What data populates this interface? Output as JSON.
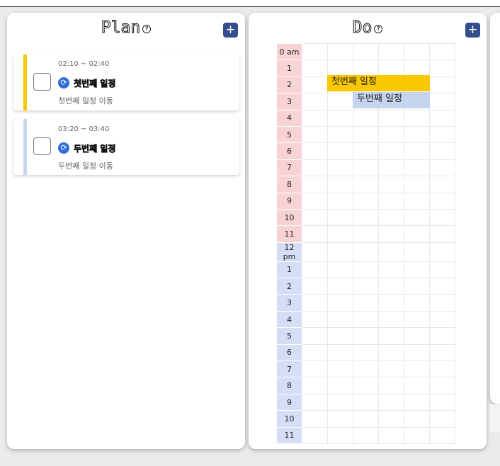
{
  "plan": {
    "title": "Plan",
    "help_icon": "?",
    "add_label": "+",
    "items": [
      {
        "time": "02:10 ~ 02:40",
        "name": "첫번째 일정",
        "desc": "첫번째 일정 이동",
        "color": "#f9c800"
      },
      {
        "time": "03:20 ~ 03:40",
        "name": "두번째 일정",
        "desc": "두번째 일정 이동",
        "color": "#c7d6ef"
      }
    ]
  },
  "do": {
    "title": "Do",
    "help_icon": "?",
    "add_label": "+",
    "hours": [
      "0 am",
      "1",
      "2",
      "3",
      "4",
      "5",
      "6",
      "7",
      "8",
      "9",
      "10",
      "11",
      "12 pm",
      "1",
      "2",
      "3",
      "4",
      "5",
      "6",
      "7",
      "8",
      "9",
      "10",
      "11"
    ],
    "events": [
      {
        "label": "첫번째 일정",
        "color": "#f9c800"
      },
      {
        "label": "두번째 일정",
        "color": "#c5d4ef"
      }
    ]
  },
  "colors": {
    "accent": "#334e8c",
    "am": "#f8d3d5",
    "pm": "#d6def6",
    "sync": "#2f6ed8"
  }
}
